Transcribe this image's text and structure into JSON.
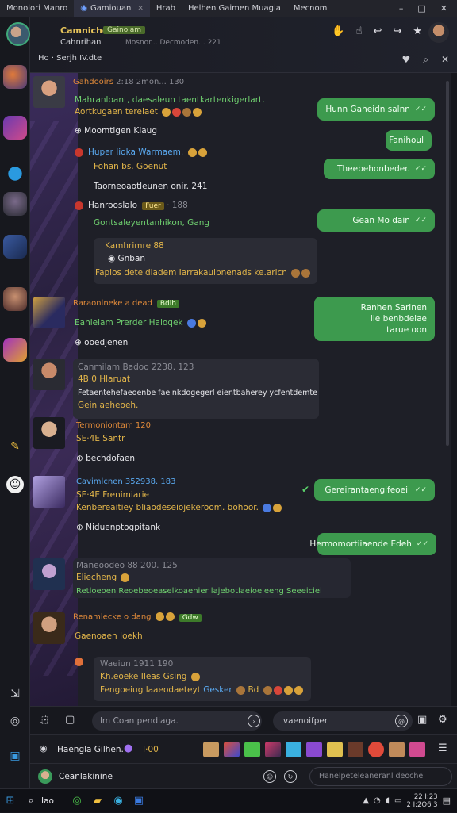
{
  "tabs": [
    {
      "label": "Monolori Manro",
      "active": false
    },
    {
      "label": "Gamiouan",
      "active": true
    },
    {
      "label": "Hrab",
      "active": false
    },
    {
      "label": "Helhen   Gaimen Muagia",
      "active": false
    },
    {
      "label": "Mecnom",
      "active": false
    }
  ],
  "window": {
    "minimize": "–",
    "maximize": "□",
    "close": "✕"
  },
  "header": {
    "title": "Camniche",
    "badge": "Gainoiam",
    "subtitle": "Cahnrihan",
    "subtitle_info": "Mosnor... Decmoden... 221",
    "pinned": "Ho · Serjh IV.dte"
  },
  "messages": {
    "m1": {
      "name": "Gahdooirs",
      "time": "2:18 2mon... 130",
      "line1": "Mahranloant, daesaleun taentkartenkigerlart,",
      "line2": "Aortkugaen terelaet",
      "line3": "Moomtigen Kiaug"
    },
    "m2": {
      "name": "Huper lioka Warmaem.",
      "line1": "Fohan bs. Goenut",
      "line2": "Taorneoaotleunen onir.  241"
    },
    "m3": {
      "name": "Hanrooslalo",
      "tag": "Fuer",
      "time": "· 188",
      "line1": "Gontsaleyentanhikon, Gang"
    },
    "m4": {
      "name": "Kamhrimre  88",
      "quote": "Gnban",
      "line1": "Faplos deteldiadem Iarrakaulbnenads ke.aricn"
    },
    "m5": {
      "name": "Raraonlneke a dead",
      "tag": "Bdih",
      "line1": "Eahleiam Prerder Haloqek",
      "line2": "ooedjenen"
    },
    "m6": {
      "name": "Canmilam Badoo  2238.  123",
      "line1": "4B·0 Hlaruat",
      "line2": "Fetaentehefaeoenbe faelnkdogegerl eientbaherey ycfentdemte",
      "line3": "Gein aeheoeh."
    },
    "m7": {
      "name": "Termoniontam  120",
      "line1": "SE·4E Santr",
      "line2": "bechdofaen"
    },
    "m8": {
      "name": "Cavimlcnen  352938. 183",
      "line1": "SE·4E Frenimiarie",
      "line2": "Kenbereaitiey bliaodeseiojekeroom. bohoor.",
      "line3": "Niduenptogpitank"
    },
    "m9": {
      "name": "Maneoodeo  88  200. 125",
      "line1": "Eliecheng",
      "line2": "Retloeoen Reoebeoeaselkoaenier lajebotlaeioeleeng Seeeiciei"
    },
    "m10": {
      "name": "Renamlecke o dang",
      "tag": "Gdw",
      "line1": "Gaenoaen Ioekh"
    },
    "m11": {
      "name": "Waeiun  1911  190",
      "line1": "Kh.eoeke IIeas Gsing",
      "line2": "Fengoeiug laaeodaeteyt",
      "line2b": "Gesker",
      "line2c": "Bd"
    }
  },
  "outgoing": [
    {
      "text": "Hunn Gaheidn salnn",
      "tick": "✓✓"
    },
    {
      "text": "Fanihoul",
      "tick": ""
    },
    {
      "text": "Theebehonbeder.",
      "tick": "✓✓"
    },
    {
      "text": "Gean Mo dain",
      "tick": "✓✓"
    },
    {
      "text": "Ranhen Sarinen",
      "text2": "Ile benbdeiae",
      "text3": "tarue oon"
    },
    {
      "text": "Gereirantaengifeoeii",
      "tick": "✓✓"
    },
    {
      "text": "Hermomortiiaende Edeh",
      "tick": "✓✓"
    }
  ],
  "composer": {
    "placeholder": "lm Coan pendiaga.",
    "second_value": "lvaenoifper"
  },
  "stickers_label": "Haengla Gilhen.",
  "sticker_count": "I·00",
  "bottom": {
    "label": "Ceanlakinine",
    "right_text": "Hanelpeteleaneranl deoche"
  },
  "taskbar": {
    "search": "Iao",
    "clock_time": "22 I:23",
    "clock_date": "2 I:2O6 3"
  },
  "colors": {
    "accent_green": "#3d9a4e",
    "gold": "#e3b64a",
    "bg": "#1e1f27"
  }
}
